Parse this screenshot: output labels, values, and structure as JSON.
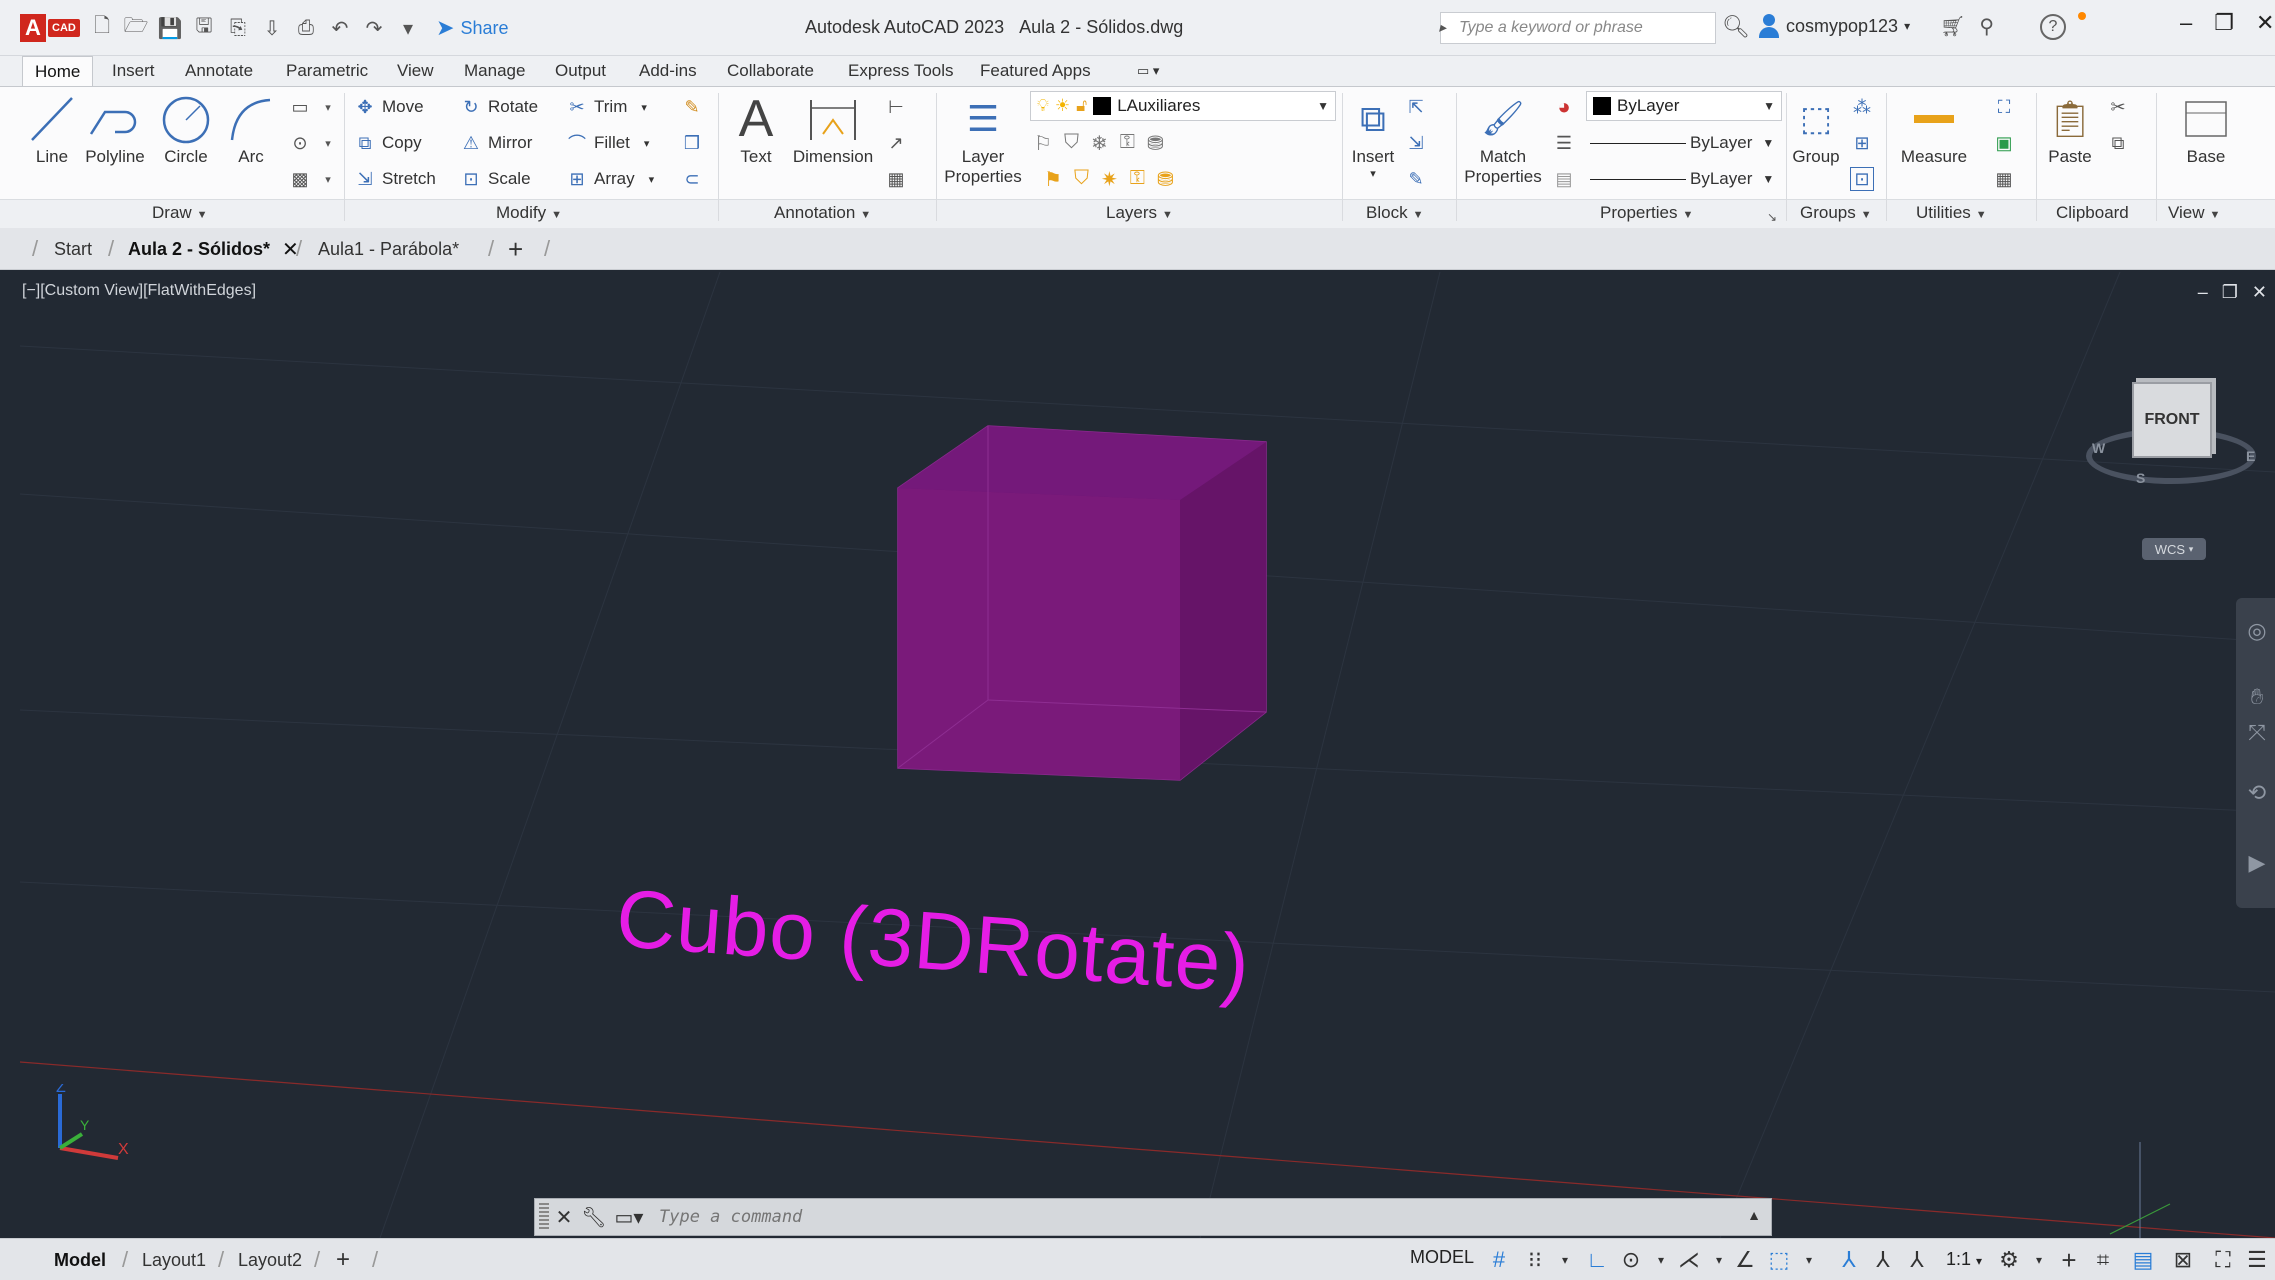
{
  "titlebar": {
    "logo_main": "A",
    "logo_sub": "CAD",
    "share_label": "Share",
    "app_title": "Autodesk AutoCAD 2023",
    "doc_title": "Aula 2 - Sólidos.dwg",
    "search_placeholder": "Type a keyword or phrase",
    "user_name": "cosmypop123"
  },
  "ribbon_tabs": [
    "Home",
    "Insert",
    "Annotate",
    "Parametric",
    "View",
    "Manage",
    "Output",
    "Add-ins",
    "Collaborate",
    "Express Tools",
    "Featured Apps"
  ],
  "ribbon": {
    "draw": {
      "title": "Draw",
      "line": "Line",
      "polyline": "Polyline",
      "circle": "Circle",
      "arc": "Arc"
    },
    "modify": {
      "title": "Modify",
      "move": "Move",
      "rotate": "Rotate",
      "trim": "Trim",
      "copy": "Copy",
      "mirror": "Mirror",
      "fillet": "Fillet",
      "stretch": "Stretch",
      "scale": "Scale",
      "array": "Array"
    },
    "annotation": {
      "title": "Annotation",
      "text": "Text",
      "dimension": "Dimension"
    },
    "layers": {
      "title": "Layers",
      "layer_properties_1": "Layer",
      "layer_properties_2": "Properties",
      "current_layer": "LAuxiliares"
    },
    "block": {
      "title": "Block",
      "insert": "Insert"
    },
    "properties": {
      "title": "Properties",
      "match_1": "Match",
      "match_2": "Properties",
      "color": "ByLayer",
      "linetype": "ByLayer",
      "lineweight": "ByLayer"
    },
    "groups": {
      "title": "Groups",
      "group": "Group"
    },
    "utilities": {
      "title": "Utilities",
      "measure": "Measure"
    },
    "clipboard": {
      "title": "Clipboard",
      "paste": "Paste"
    },
    "view": {
      "title": "View",
      "base": "Base"
    }
  },
  "doc_tabs": {
    "start": "Start",
    "active": "Aula 2 - Sólidos*",
    "other": "Aula1 - Parábola*"
  },
  "viewport": {
    "label": "[−][Custom View][FlatWithEdges]",
    "caption": "Cubo (3DRotate)",
    "viewcube_face": "FRONT",
    "compass": {
      "w": "W",
      "s": "S",
      "e": "E"
    },
    "wcs": "WCS",
    "ucs": {
      "z": "Z",
      "y": "Y",
      "x": "X"
    },
    "cube_color": "#7a1a7a",
    "caption_color": "#e51de5"
  },
  "command": {
    "placeholder": "Type a command"
  },
  "layout_tabs": [
    "Model",
    "Layout1",
    "Layout2"
  ],
  "status": {
    "model": "MODEL",
    "scale": "1:1"
  }
}
